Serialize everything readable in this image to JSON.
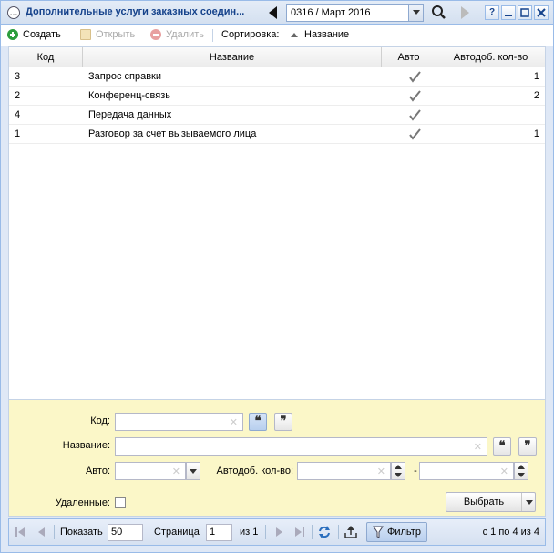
{
  "header": {
    "title": "Дополнительные услуги заказных соедин...",
    "period_value": "0316 / Март 2016",
    "help_label": "?"
  },
  "toolbar": {
    "create_label": "Создать",
    "open_label": "Открыть",
    "delete_label": "Удалить",
    "sort_label": "Сортировка:",
    "sort_field": "Название"
  },
  "grid": {
    "columns": [
      "Код",
      "Название",
      "Авто",
      "Автодоб. кол-во"
    ],
    "rows": [
      {
        "code": "3",
        "name": "Запрос справки",
        "auto": true,
        "qty": "1"
      },
      {
        "code": "2",
        "name": "Конференц-связь",
        "auto": true,
        "qty": "2"
      },
      {
        "code": "4",
        "name": "Передача данных",
        "auto": true,
        "qty": ""
      },
      {
        "code": "1",
        "name": "Разговор за счет вызываемого лица",
        "auto": true,
        "qty": "1"
      }
    ]
  },
  "filter": {
    "code_label": "Код:",
    "name_label": "Название:",
    "auto_label": "Авто:",
    "autoqty_label": "Автодоб. кол-во:",
    "range_dash": "-",
    "deleted_label": "Удаленные:",
    "select_label": "Выбрать",
    "quote_open": "❝",
    "quote_close": "❞"
  },
  "pager": {
    "show_label": "Показать",
    "page_size": "50",
    "page_label": "Страница",
    "page_value": "1",
    "of_label": "из 1",
    "filter_label": "Фильтр",
    "range_label": "с 1 по 4 из 4"
  },
  "colors": {
    "accent": "#15428b",
    "filter_bg": "#fbf7c8",
    "create_icon": "#2e9e3e",
    "delete_icon": "#e07070"
  }
}
